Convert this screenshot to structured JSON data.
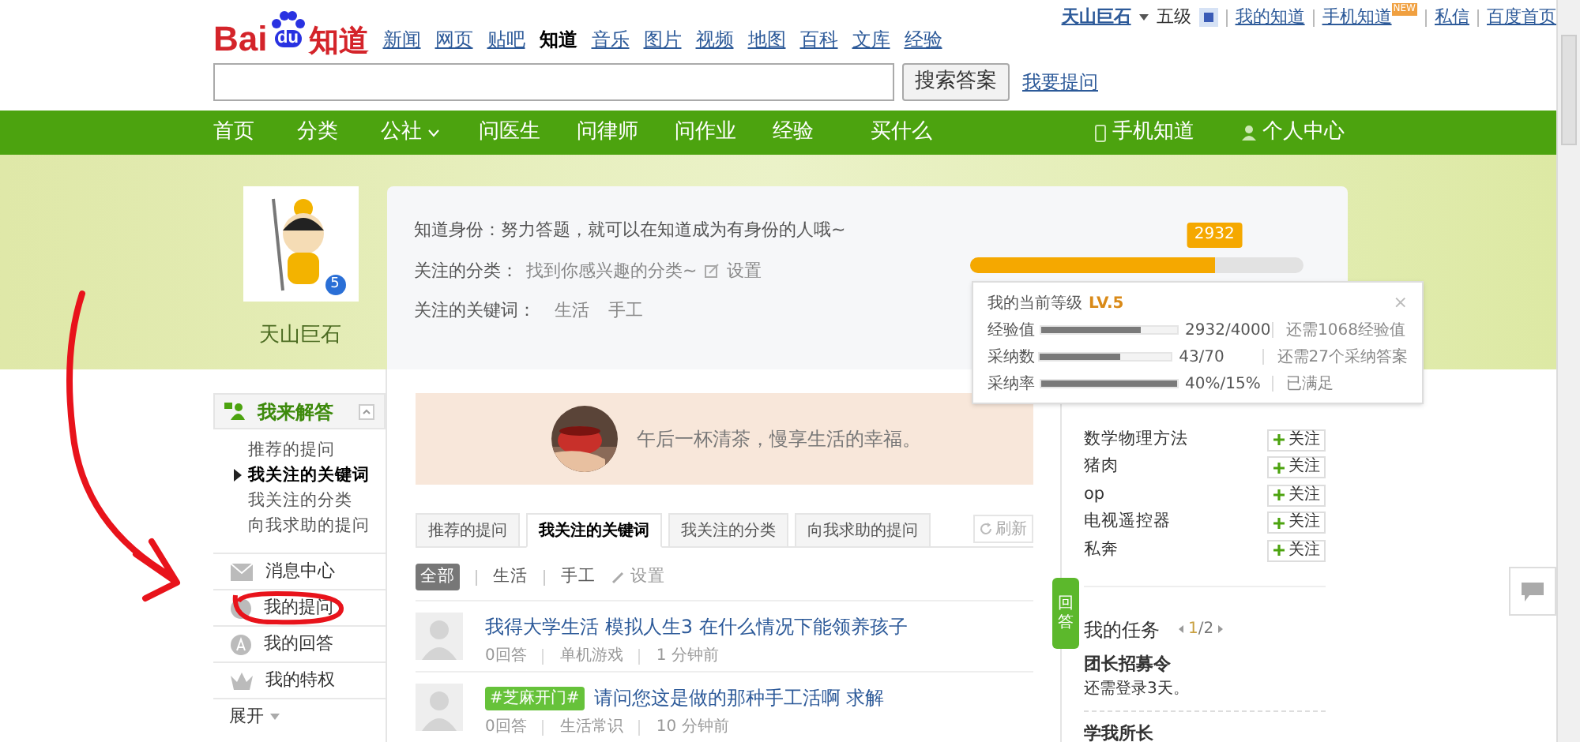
{
  "top_bar": {
    "user": "天山巨石",
    "level": "五级",
    "links": [
      "我的知道",
      "手机知道",
      "私信",
      "百度首页"
    ],
    "new_badge": "NEW"
  },
  "logo": {
    "text": "Bai",
    "du": "du",
    "suffix": "知道"
  },
  "product_links": [
    {
      "label": "新闻",
      "selected": false
    },
    {
      "label": "网页",
      "selected": false
    },
    {
      "label": "贴吧",
      "selected": false
    },
    {
      "label": "知道",
      "selected": true
    },
    {
      "label": "音乐",
      "selected": false
    },
    {
      "label": "图片",
      "selected": false
    },
    {
      "label": "视频",
      "selected": false
    },
    {
      "label": "地图",
      "selected": false
    },
    {
      "label": "百科",
      "selected": false
    },
    {
      "label": "文库",
      "selected": false
    },
    {
      "label": "经验",
      "selected": false
    }
  ],
  "search": {
    "button": "搜索答案",
    "ask_link": "我要提问"
  },
  "nav": {
    "items": [
      {
        "label": "首页",
        "dropdown": false
      },
      {
        "label": "分类",
        "dropdown": false
      },
      {
        "label": "公社",
        "dropdown": true
      },
      {
        "label": "问医生",
        "dropdown": false
      },
      {
        "label": "问律师",
        "dropdown": false
      },
      {
        "label": "问作业",
        "dropdown": false
      },
      {
        "label": "经验",
        "dropdown": false
      },
      {
        "label": "买什么",
        "dropdown": false
      }
    ],
    "right": [
      "手机知道",
      "个人中心"
    ]
  },
  "profile": {
    "name": "天山巨石",
    "badge": "5",
    "identity_label": "知道身份：",
    "identity_text": "努力答题，就可以在知道成为有身份的人哦~",
    "category_label": "关注的分类：",
    "category_text": "找到你感兴趣的分类~",
    "category_setting": "设置",
    "keyword_label": "关注的关键词：",
    "keywords": [
      "生活",
      "手工"
    ],
    "exp_badge": "2932",
    "exp_bar": {
      "level": 0.733
    }
  },
  "level_popup": {
    "title": "我的当前等级",
    "level": "LV.5",
    "close": "×",
    "rows": [
      {
        "label": "经验值",
        "level": 0.733,
        "value": "2932/4000",
        "note": "还需1068经验值"
      },
      {
        "label": "采纳数",
        "level": 0.614,
        "value": "43/70",
        "note": "还需27个采纳答案"
      },
      {
        "label": "采纳率",
        "level": 1,
        "value": "40%/15%",
        "note": "已满足"
      }
    ]
  },
  "sidebar": {
    "section": "我来解答",
    "sub_items": [
      {
        "label": "推荐的提问",
        "selected": false
      },
      {
        "label": "我关注的关键词",
        "selected": true
      },
      {
        "label": "我关注的分类",
        "selected": false
      },
      {
        "label": "向我求助的提问",
        "selected": false
      }
    ],
    "items": [
      {
        "label": "消息中心",
        "kind": "mail"
      },
      {
        "label": "我的提问",
        "kind": "question"
      },
      {
        "label": "我的回答",
        "kind": "answer"
      },
      {
        "label": "我的特权",
        "kind": "crown"
      }
    ],
    "expand": "展开"
  },
  "banner": {
    "text": "午后一杯清茶，慢享生活的幸福。"
  },
  "tabs": [
    {
      "label": "推荐的提问",
      "selected": false
    },
    {
      "label": "我关注的关键词",
      "selected": true
    },
    {
      "label": "我关注的分类",
      "selected": false
    },
    {
      "label": "向我求助的提问",
      "selected": false
    }
  ],
  "refresh": "刷新",
  "filters": [
    {
      "label": "全部",
      "selected": true
    },
    {
      "label": "生活",
      "selected": false
    },
    {
      "label": "手工",
      "selected": false
    }
  ],
  "filter_setting": "设置",
  "questions": [
    {
      "title": "我得大学生活 模拟人生3 在什么情况下能领养孩子",
      "answers": "0回答",
      "category": "单机游戏",
      "time": "1 分钟前"
    },
    {
      "tag": "#芝麻开门#",
      "title": "请问您这是做的那种手工活啊 求解",
      "answers": "0回答",
      "category": "生活常识",
      "time": "10 分钟前"
    }
  ],
  "answer_tab": "回答",
  "interests": [
    {
      "label": "数学物理方法",
      "button": "关注"
    },
    {
      "label": "猪肉",
      "button": "关注"
    },
    {
      "label": "op",
      "button": "关注"
    },
    {
      "label": "电视遥控器",
      "button": "关注"
    },
    {
      "label": "私奔",
      "button": "关注"
    }
  ],
  "tasks": {
    "title": "我的任务",
    "page": "1",
    "total": "/2",
    "task_title": "团长招募令",
    "task_text": "还需登录3天。",
    "next_title": "学我所长"
  }
}
